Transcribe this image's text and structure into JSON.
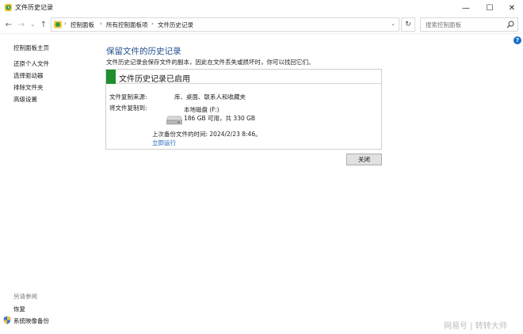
{
  "window": {
    "title": "文件历史记录",
    "min_glyph": "—",
    "max_glyph": "☐",
    "close_glyph": "✕"
  },
  "nav": {
    "back_glyph": "←",
    "forward_glyph": "→",
    "recent_glyph": "⌄",
    "up_glyph": "↑",
    "breadcrumbs": [
      "控制面板",
      "所有控制面板项",
      "文件历史记录"
    ],
    "sep_glyph": "›",
    "dropdown_glyph": "⌄",
    "refresh_glyph": "↻",
    "search_placeholder": "搜索控制面板"
  },
  "sidebar": {
    "home": "控制面板主页",
    "items": [
      "还原个人文件",
      "选择驱动器",
      "排除文件夹",
      "高级设置"
    ],
    "see_also_title": "另请参阅",
    "see_also": [
      "恢复",
      "系统映像备份"
    ]
  },
  "help": {
    "glyph": "?"
  },
  "main": {
    "title": "保留文件的历史记录",
    "description": "文件历史记录会保存文件的副本，因此在文件丢失或损坏时，你可以找回它们。",
    "status": "文件历史记录已启用",
    "source_label": "文件复制来源:",
    "source_value": "库、桌面、联系人和收藏夹",
    "dest_label": "将文件复制到:",
    "drive_name": "本地磁盘 (F:)",
    "drive_space": "186 GB 可用，共 330 GB",
    "last_backup": "上次备份文件的时间: 2024/2/23 8:46。",
    "run_now": "立即运行",
    "close_button": "关闭"
  },
  "watermark": "网易号 | 转转大师",
  "colors": {
    "status_green": "#1f8f2c",
    "title_blue": "#1e4e8c",
    "link_blue": "#1a5fb4"
  }
}
